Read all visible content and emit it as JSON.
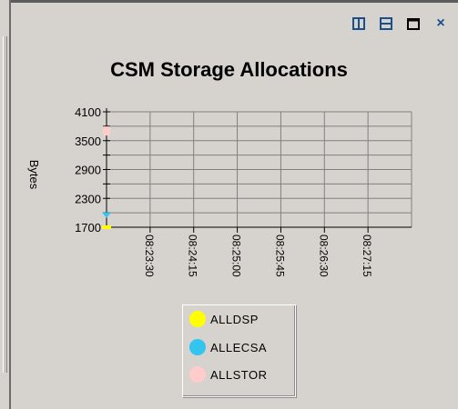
{
  "window": {
    "buttons": [
      {
        "name": "tile-vertical-icon"
      },
      {
        "name": "tile-horizontal-icon"
      },
      {
        "name": "maximize-icon"
      },
      {
        "name": "close-icon",
        "label": "×"
      }
    ]
  },
  "colors": {
    "background": "#d6d3ce",
    "accent_icons": "#1b4f8a",
    "grid": "#808080"
  },
  "chart_data": {
    "type": "line",
    "title": "CSM Storage Allocations",
    "ylabel": "Bytes",
    "xlabel": "",
    "ylim": [
      1700,
      4100
    ],
    "yticks": [
      "4100",
      "3500",
      "2900",
      "2300",
      "1700"
    ],
    "ytick_values": [
      4100,
      3500,
      2900,
      2300,
      1700
    ],
    "xticks": [
      "08:23:30",
      "08:24:15",
      "08:25:00",
      "08:25:45",
      "08:26:30",
      "08:27:15"
    ],
    "grid": true,
    "legend_placement": "bottom",
    "series": [
      {
        "name": "ALLDSP",
        "color": "#ffff00",
        "x": [
          "08:22:45"
        ],
        "values": [
          1700
        ]
      },
      {
        "name": "ALLECSA",
        "color": "#33c4f0",
        "x": [
          "08:22:45"
        ],
        "values": [
          1950
        ]
      },
      {
        "name": "ALLSTOR",
        "color": "#ffcccc",
        "x": [
          "08:22:45"
        ],
        "values": [
          3700
        ]
      }
    ]
  }
}
